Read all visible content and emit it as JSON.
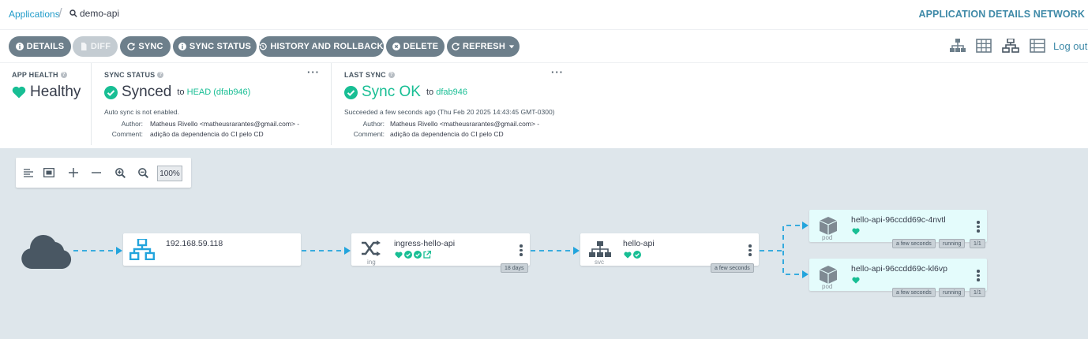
{
  "breadcrumb": {
    "apps": "Applications",
    "current": "demo-api"
  },
  "title": "APPLICATION DETAILS NETWORK",
  "toolbar": {
    "details": "DETAILS",
    "diff": "DIFF",
    "sync": "SYNC",
    "sync_status": "SYNC STATUS",
    "history": "HISTORY AND ROLLBACK",
    "delete": "DELETE",
    "refresh": "REFRESH",
    "logout": "Log out"
  },
  "app_health": {
    "title": "APP HEALTH",
    "value": "Healthy"
  },
  "sync_status": {
    "title": "SYNC STATUS",
    "value": "Synced",
    "to_prefix": "to",
    "target": "HEAD (dfab946)",
    "auto_sync": "Auto sync is not enabled.",
    "author_label": "Author:",
    "author": "Matheus Rivello <matheusrarantes@gmail.com> -",
    "comment_label": "Comment:",
    "comment": "adição da dependencia do CI pelo CD"
  },
  "last_sync": {
    "title": "LAST SYNC",
    "value": "Sync OK",
    "to_prefix": "to",
    "target": "dfab946",
    "succeeded": "Succeeded a few seconds ago (Thu Feb 20 2025 14:43:45 GMT-0300)",
    "author_label": "Author:",
    "author": "Matheus Rivello <matheusrarantes@gmail.com> -",
    "comment_label": "Comment:",
    "comment": "adição da dependencia do CI pelo CD"
  },
  "zoom": {
    "level": "100%"
  },
  "nodes": {
    "lb": {
      "name": "192.168.59.118"
    },
    "ingress": {
      "name": "ingress-hello-api",
      "kind": "ing",
      "age": "18 days"
    },
    "service": {
      "name": "hello-api",
      "kind": "svc",
      "age": "a few seconds"
    },
    "pod1": {
      "name": "hello-api-96ccdd69c-4nvtl",
      "kind": "pod",
      "age": "a few seconds",
      "status": "running",
      "ready": "1/1"
    },
    "pod2": {
      "name": "hello-api-96ccdd69c-kl6vp",
      "kind": "pod",
      "age": "a few seconds",
      "status": "running",
      "ready": "1/1"
    }
  },
  "colors": {
    "accent": "#1f9bc9",
    "healthy": "#18be94",
    "button": "#6d7f8b",
    "graph_bg": "#dee6eb",
    "pod_bg": "#e4fcfc"
  }
}
